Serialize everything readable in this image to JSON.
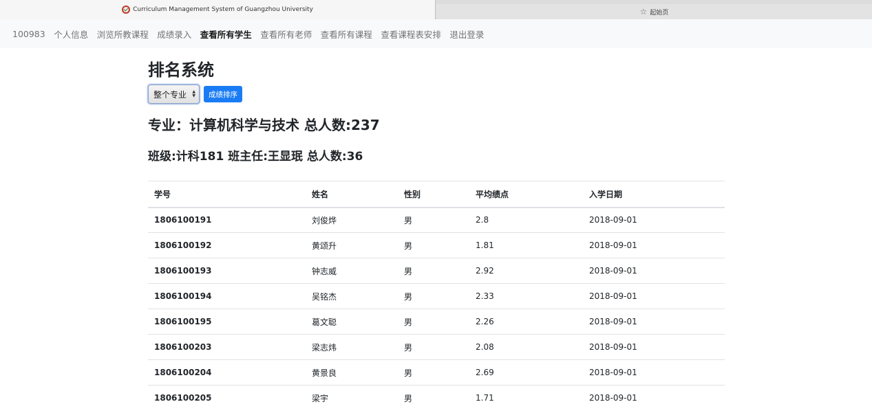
{
  "browser": {
    "active_tab_title": "Curriculum Management System of Guangzhou University",
    "inactive_tab_title": "起始页",
    "inactive_tab_icon": "star-icon"
  },
  "navbar": {
    "items": [
      {
        "label": "100983",
        "active": false
      },
      {
        "label": "个人信息",
        "active": false
      },
      {
        "label": "浏览所教课程",
        "active": false
      },
      {
        "label": "成绩录入",
        "active": false
      },
      {
        "label": "查看所有学生",
        "active": true
      },
      {
        "label": "查看所有老师",
        "active": false
      },
      {
        "label": "查看所有课程",
        "active": false
      },
      {
        "label": "查看课程表安排",
        "active": false
      },
      {
        "label": "退出登录",
        "active": false
      }
    ]
  },
  "page": {
    "title": "排名系统",
    "scope_select_value": "整个专业",
    "sort_button_label": "成绩排序",
    "major_heading": "专业：计算机科学与技术 总人数:237",
    "class_heading": "班级:计科181 班主任:王显珉 总人数:36"
  },
  "table": {
    "headers": [
      "学号",
      "姓名",
      "性别",
      "平均绩点",
      "入学日期"
    ],
    "rows": [
      [
        "1806100191",
        "刘俊烨",
        "男",
        "2.8",
        "2018-09-01"
      ],
      [
        "1806100192",
        "黄颂升",
        "男",
        "1.81",
        "2018-09-01"
      ],
      [
        "1806100193",
        "钟志威",
        "男",
        "2.92",
        "2018-09-01"
      ],
      [
        "1806100194",
        "吴铭杰",
        "男",
        "2.33",
        "2018-09-01"
      ],
      [
        "1806100195",
        "葛文聪",
        "男",
        "2.26",
        "2018-09-01"
      ],
      [
        "1806100203",
        "梁志炜",
        "男",
        "2.08",
        "2018-09-01"
      ],
      [
        "1806100204",
        "黄景良",
        "男",
        "2.69",
        "2018-09-01"
      ],
      [
        "1806100205",
        "梁宇",
        "男",
        "1.71",
        "2018-09-01"
      ]
    ]
  },
  "colors": {
    "primary_button": "#1a7cf5",
    "navbar_bg": "#f8f9fa",
    "table_border": "#dee2e6"
  }
}
